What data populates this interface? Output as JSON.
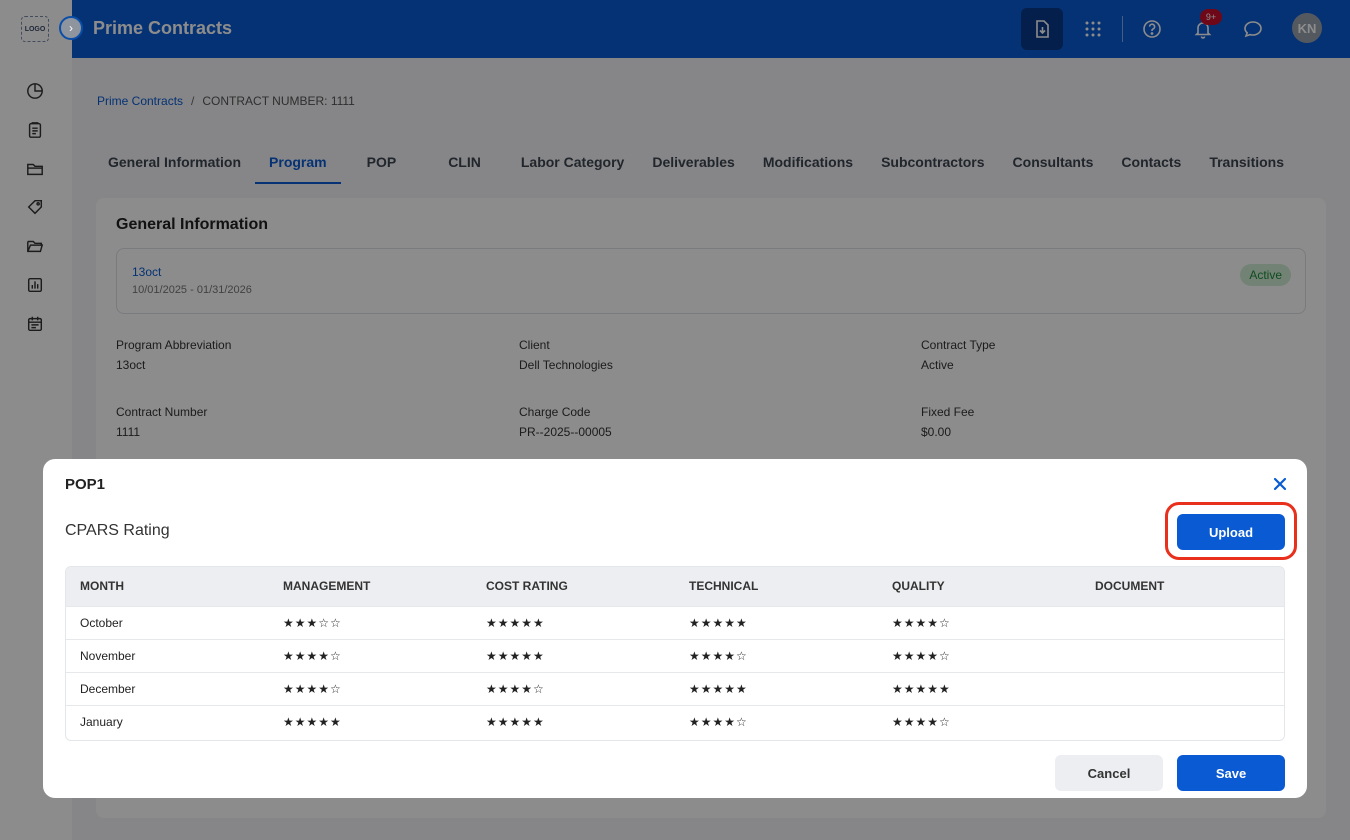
{
  "sidebar": {
    "logo_text": "LOGO",
    "collapse_glyph": "›",
    "items": [
      {
        "icon": "pie-chart-icon"
      },
      {
        "icon": "clipboard-icon"
      },
      {
        "icon": "folder-icon"
      },
      {
        "icon": "tag-icon"
      },
      {
        "icon": "folder-open-icon"
      },
      {
        "icon": "bar-chart-icon"
      },
      {
        "icon": "calendar-icon"
      }
    ]
  },
  "header": {
    "title": "Prime Contracts",
    "notification_count": "9+",
    "avatar_initials": "KN",
    "actions": [
      "download-icon",
      "apps-grid-icon",
      "help-icon",
      "bell-icon",
      "chat-icon"
    ]
  },
  "breadcrumb": {
    "parent": "Prime Contracts",
    "separator": "/",
    "current": "CONTRACT NUMBER: 1111"
  },
  "tabs": [
    {
      "label": "General Information",
      "active": false
    },
    {
      "label": "Program",
      "active": true
    },
    {
      "label": "POP",
      "active": false
    },
    {
      "label": "CLIN",
      "active": false
    },
    {
      "label": "Labor Category",
      "active": false
    },
    {
      "label": "Deliverables",
      "active": false
    },
    {
      "label": "Modifications",
      "active": false
    },
    {
      "label": "Subcontractors",
      "active": false
    },
    {
      "label": "Consultants",
      "active": false
    },
    {
      "label": "Contacts",
      "active": false
    },
    {
      "label": "Transitions",
      "active": false
    }
  ],
  "general": {
    "title": "General Information",
    "program_name": "13oct",
    "program_dates": "10/01/2025 - 01/31/2026",
    "status": "Active",
    "fields": [
      {
        "label": "Program Abbreviation",
        "value": "13oct"
      },
      {
        "label": "Client",
        "value": "Dell Technologies"
      },
      {
        "label": "Contract Type",
        "value": "Active"
      },
      {
        "label": "Contract Number",
        "value": "1111"
      },
      {
        "label": "Charge Code",
        "value": "PR--2025--00005"
      },
      {
        "label": "Fixed Fee",
        "value": "$0.00"
      }
    ]
  },
  "modal": {
    "title": "POP1",
    "section_title": "CPARS Rating",
    "upload_label": "Upload",
    "cancel_label": "Cancel",
    "save_label": "Save",
    "columns": [
      "MONTH",
      "MANAGEMENT",
      "COST RATING",
      "TECHNICAL",
      "QUALITY",
      "DOCUMENT"
    ],
    "rows": [
      {
        "month": "October",
        "management": 3,
        "cost_rating": 5,
        "technical": 5,
        "quality": 4,
        "document": ""
      },
      {
        "month": "November",
        "management": 4,
        "cost_rating": 5,
        "technical": 4,
        "quality": 4,
        "document": ""
      },
      {
        "month": "December",
        "management": 4,
        "cost_rating": 4,
        "technical": 5,
        "quality": 5,
        "document": ""
      },
      {
        "month": "January",
        "management": 5,
        "cost_rating": 5,
        "technical": 4,
        "quality": 4,
        "document": ""
      }
    ],
    "max_stars": 5
  },
  "colors": {
    "primary": "#0a5bd3",
    "highlight": "#e8301c",
    "active_badge_bg": "#cfeed6",
    "active_badge_text": "#1f8a3a"
  }
}
